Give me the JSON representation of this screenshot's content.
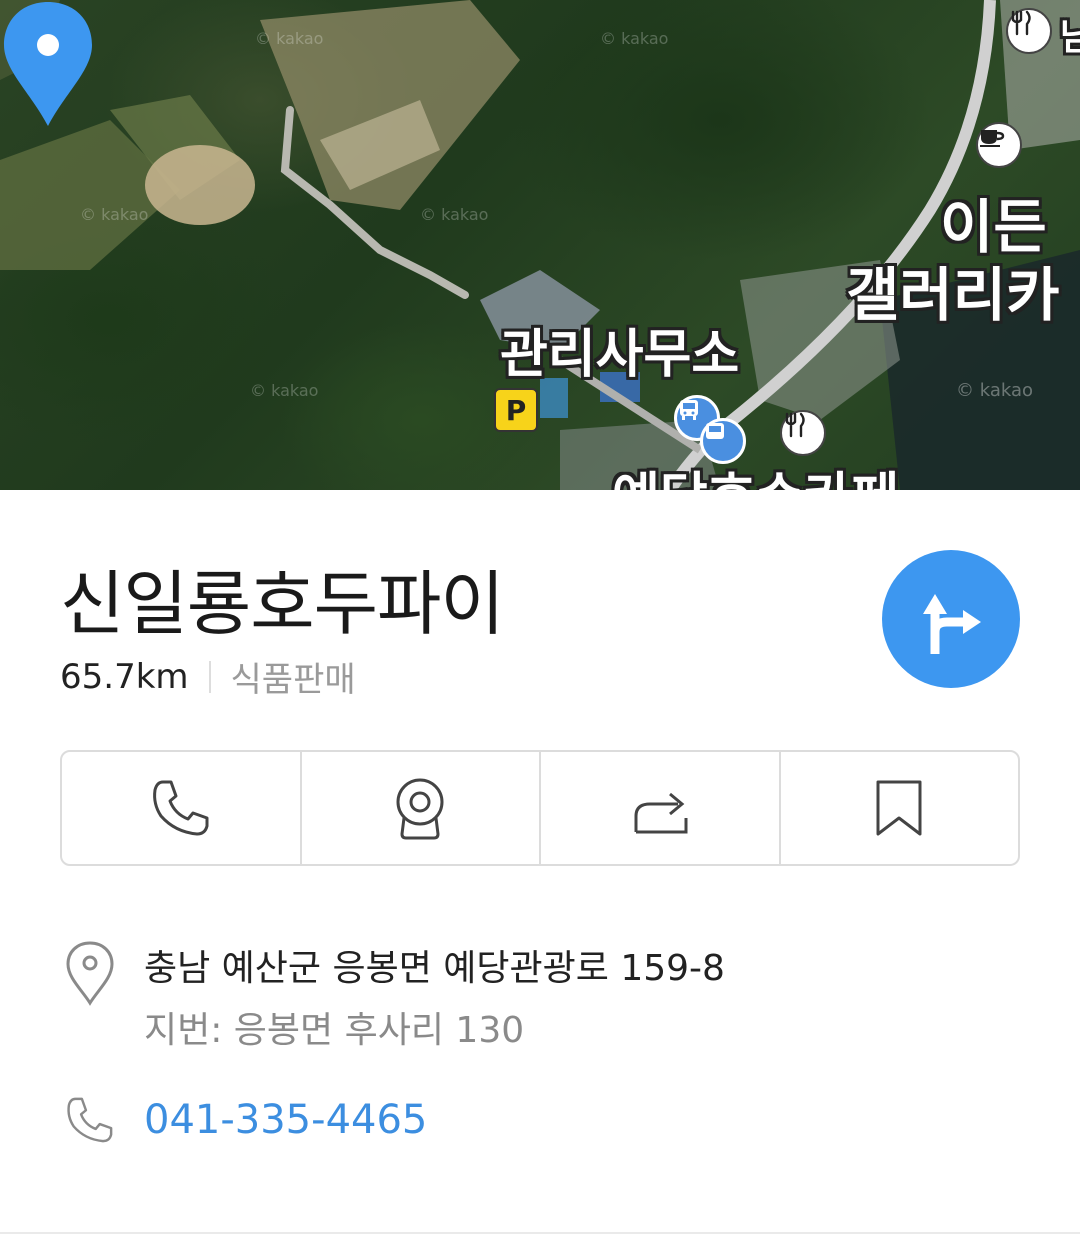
{
  "map": {
    "labels": {
      "office": "관리사무소",
      "gallery_top": "이든",
      "gallery_bottom": "갤러리카",
      "partial_bottom": "예당호수카페",
      "partial_top_right": "남"
    },
    "watermarks": [
      "© kakao",
      "© kakao",
      "© kakao",
      "© kakao",
      "© kakao",
      "© kakao"
    ],
    "parking_label": "P",
    "pin_color": "#3d97f0"
  },
  "place": {
    "name": "신일룡호두파이",
    "distance": "65.7km",
    "category": "식품판매"
  },
  "actions": {
    "items": [
      {
        "icon": "phone-icon"
      },
      {
        "icon": "roadview-camera-icon"
      },
      {
        "icon": "share-icon"
      },
      {
        "icon": "bookmark-icon"
      }
    ]
  },
  "address": {
    "road": "충남 예산군 응봉면 예당관광로 159-8",
    "lot": "지번: 응봉면 후사리 130"
  },
  "phone": {
    "number": "041-335-4465"
  },
  "colors": {
    "accent": "#3d97f0",
    "phone_link": "#3c8ee0",
    "secondary_text": "#8a8a8a",
    "border": "#dcdcdc"
  }
}
